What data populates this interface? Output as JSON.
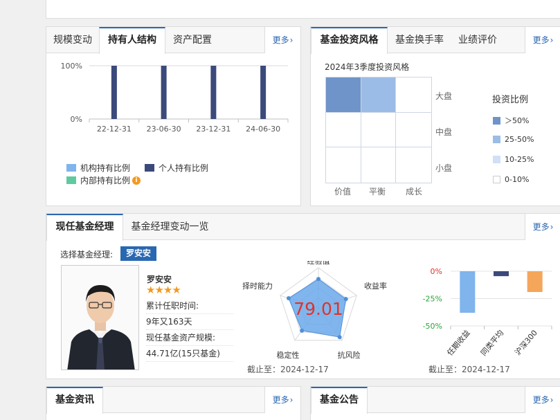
{
  "colors": {
    "accent": "#2a67b1",
    "individual_bar": "#3b4a7b",
    "institution": "#7fb4ec",
    "insider": "#5fcaa0",
    "radar_fill": "#6aa9ea",
    "perf_bar_1": "#7fb4ec",
    "perf_bar_2": "#3b4a7b",
    "perf_bar_3": "#f5a65b",
    "negative": "#2aa33a",
    "zero": "#e0322a"
  },
  "holder_panel": {
    "tabs": [
      "规模变动",
      "持有人结构",
      "资产配置"
    ],
    "more": "更多",
    "y_ticks": [
      "100%",
      "0%"
    ],
    "legend": {
      "institution": "机构持有比例",
      "individual": "个人持有比例",
      "insider": "内部持有比例",
      "info_icon": "info-icon"
    }
  },
  "style_panel": {
    "tabs": [
      "基金投资风格",
      "基金换手率",
      "业绩评价"
    ],
    "more": "更多",
    "subtitle": "2024年3季度投资风格",
    "row_labels": [
      "大盘",
      "中盘",
      "小盘"
    ],
    "col_labels": [
      "价值",
      "平衡",
      "成长"
    ],
    "grid": [
      [
        "darker",
        "medium",
        "empty"
      ],
      [
        "empty",
        "empty",
        "empty"
      ],
      [
        "empty",
        "empty",
        "empty"
      ]
    ],
    "legend_title": "投资比例",
    "legend": [
      {
        "label": "＞50%",
        "color": "#6e94c9"
      },
      {
        "label": "25-50%",
        "color": "#9bbce6"
      },
      {
        "label": "10-25%",
        "color": "#cfe0f7"
      },
      {
        "label": "0-10%",
        "color": "#ffffff"
      }
    ]
  },
  "manager_panel": {
    "tabs": [
      "现任基金经理",
      "基金经理变动一览"
    ],
    "more": "更多",
    "select_label": "选择基金经理:",
    "selected_manager": "罗安安",
    "name": "罗安安",
    "stars": "★★★★",
    "tenure_label": "累计任职时间:",
    "tenure_value": "9年又163天",
    "aum_label": "现任基金资产规模:",
    "aum_value": "44.71亿(15只基金)",
    "radar": {
      "score": "79.01",
      "axes": [
        "经验值",
        "收益率",
        "抗风险",
        "稳定性",
        "择时能力"
      ],
      "values": [
        0.72,
        0.72,
        0.9,
        0.7,
        0.78
      ],
      "date_label": "截止至：2024-12-17"
    },
    "performance": {
      "y_ticks": [
        "0%",
        "-25%",
        "-50%"
      ],
      "ylim": [
        -50,
        0
      ],
      "categories": [
        "任期收益",
        "同类平均",
        "沪深300"
      ],
      "values": [
        -38,
        -4.5,
        -19
      ],
      "date_label": "截止至：2024-12-17"
    }
  },
  "news_panel": {
    "title": "基金资讯",
    "more": "更多"
  },
  "notice_panel": {
    "title": "基金公告",
    "more": "更多"
  },
  "holder_chart_data": {
    "type": "bar",
    "categories": [
      "22-12-31",
      "23-06-30",
      "23-12-31",
      "24-06-30"
    ],
    "series": [
      {
        "name": "个人持有比例",
        "values": [
          100,
          100,
          100,
          100
        ]
      }
    ],
    "ylim": [
      0,
      100
    ]
  }
}
